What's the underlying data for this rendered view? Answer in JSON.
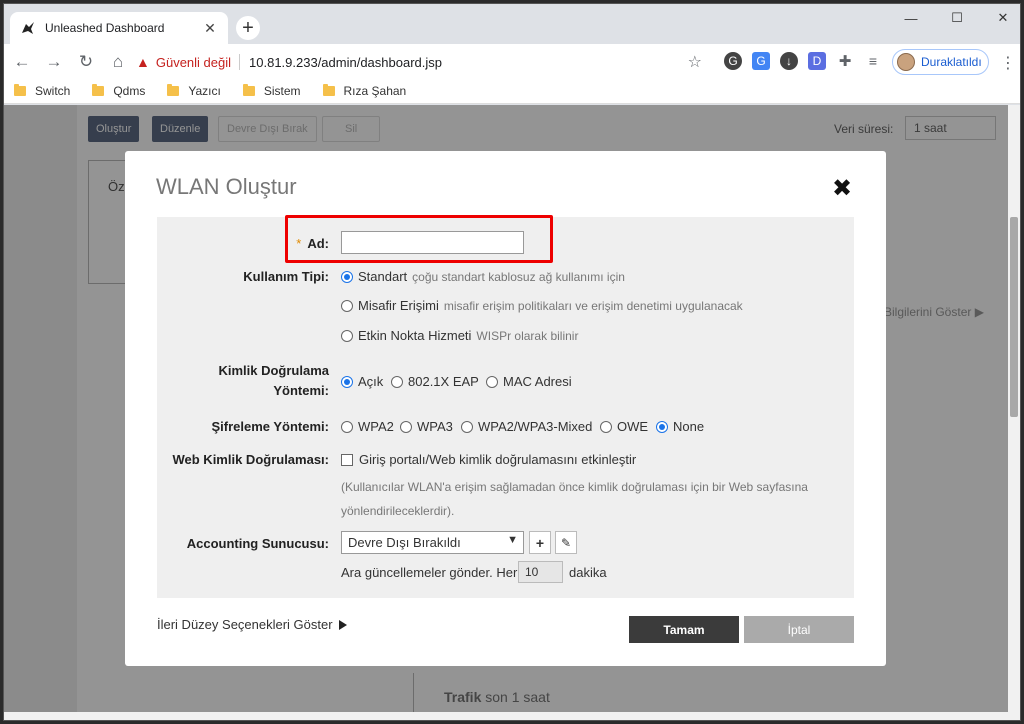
{
  "browser": {
    "tab_title": "Unleashed Dashboard",
    "security_label": "Güvenli değil",
    "url": "10.81.9.233/admin/dashboard.jsp",
    "profile_label": "Duraklatıldı",
    "bookmarks": [
      "Switch",
      "Qdms",
      "Yazıcı",
      "Sistem",
      "Rıza Şahan"
    ]
  },
  "page": {
    "buttons": [
      "Oluştur",
      "Düzenle",
      "Devre Dışı Bırak",
      "Sil"
    ],
    "veri_label": "Veri süresi:",
    "veri_value": "1 saat",
    "summary_label": "Öz",
    "bilgi_link": "Bilgilerini Göster",
    "trafik_label": "Trafik",
    "trafik_sub": "son 1 saat"
  },
  "modal": {
    "title": "WLAN Oluştur",
    "close_symbol": "✖",
    "name": {
      "label": "Ad:",
      "required_mark": "*",
      "value": ""
    },
    "usage": {
      "label": "Kullanım Tipi:",
      "options": [
        {
          "label": "Standart",
          "desc": "çoğu standart kablosuz ağ kullanımı için",
          "selected": true
        },
        {
          "label": "Misafir Erişimi",
          "desc": "misafir erişim politikaları ve erişim denetimi uygulanacak",
          "selected": false
        },
        {
          "label": "Etkin Nokta Hizmeti",
          "desc": "WISPr olarak bilinir",
          "selected": false
        }
      ]
    },
    "auth": {
      "label_line1": "Kimlik Doğrulama",
      "label_line2": "Yöntemi:",
      "options": [
        {
          "label": "Açık",
          "selected": true
        },
        {
          "label": "802.1X EAP",
          "selected": false
        },
        {
          "label": "MAC Adresi",
          "selected": false
        }
      ]
    },
    "encryption": {
      "label": "Şifreleme Yöntemi:",
      "options": [
        {
          "label": "WPA2",
          "selected": false
        },
        {
          "label": "WPA3",
          "selected": false
        },
        {
          "label": "WPA2/WPA3-Mixed",
          "selected": false
        },
        {
          "label": "OWE",
          "selected": false
        },
        {
          "label": "None",
          "selected": true
        }
      ]
    },
    "web_auth": {
      "label": "Web Kimlik Doğrulaması:",
      "checkbox_label": "Giriş portalı/Web kimlik doğrulamasını etkinleştir",
      "checked": false,
      "note_line1": "(Kullanıcılar WLAN'a erişim sağlamadan önce kimlik doğrulaması için bir Web sayfasına",
      "note_line2": "yönlendirileceklerdir)."
    },
    "accounting": {
      "label": "Accounting Sunucusu:",
      "selected": "Devre Dışı Bırakıldı",
      "interim_prefix": "Ara güncellemeler gönder. Her",
      "interim_value": "10",
      "interim_unit": "dakika"
    },
    "advanced_link": "İleri Düzey Seçenekleri Göster",
    "ok_label": "Tamam",
    "cancel_label": "İptal"
  }
}
